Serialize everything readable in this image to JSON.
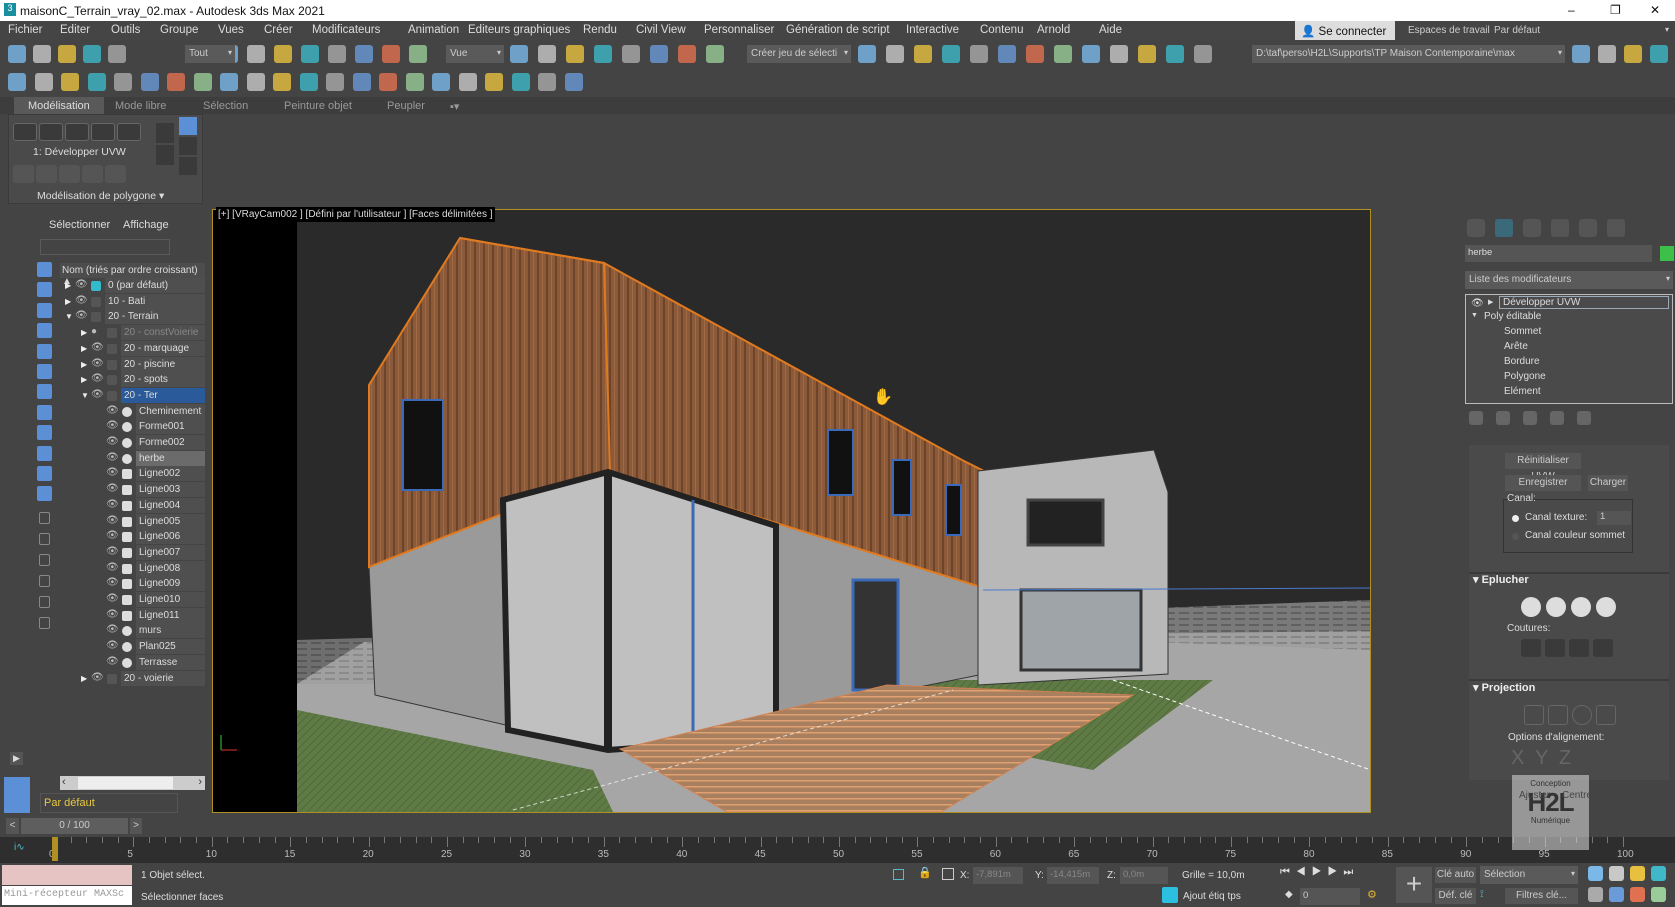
{
  "window": {
    "title": "maisonC_Terrain_vray_02.max - Autodesk 3ds Max 2021",
    "minimize": "–",
    "maximize": "❐",
    "close": "✕"
  },
  "menu": [
    "Fichier",
    "Editer",
    "Outils",
    "Groupe",
    "Vues",
    "Créer",
    "Modificateurs",
    "Animation",
    "Editeurs graphiques",
    "Rendu",
    "Civil View",
    "Personnaliser",
    "Génération de script",
    "Interactive",
    "Contenu",
    "Arnold",
    "Aide"
  ],
  "account": {
    "signin": "Se connecter",
    "workspace_label": "Espaces de travail:",
    "workspace_value": "Par défaut"
  },
  "toolbar": {
    "selection_filter": "Tout",
    "ref_coord": "Vue",
    "named_selection": "Créer jeu de sélecti",
    "project_path": "D:\\taf\\perso\\H2L\\Supports\\TP Maison Contemporaine\\max",
    "row1_icons": [
      "undo-icon",
      "redo-icon",
      "link-icon",
      "unlink-icon",
      "bind-spacewarp-icon"
    ],
    "row1b_icons": [
      "select-object-icon",
      "select-by-name-icon",
      "rect-selection-icon",
      "window-crossing-icon",
      "move-icon",
      "rotate-icon",
      "scale-icon",
      "manipulate-icon"
    ],
    "row1c_icons": [
      "mirror-axis-icon",
      "pivot-icon",
      "keyboard-shortcut-icon",
      "snap-3d-icon",
      "angle-snap-icon",
      "percent-snap-icon",
      "spinner-snap-icon",
      "edit-named-sel-icon"
    ],
    "row1d_icons": [
      "mirror-icon",
      "align-icon",
      "scene-explorer-icon",
      "layer-explorer-icon",
      "toggle-ribbon-icon",
      "curve-editor-icon",
      "schematic-icon",
      "material-editor-icon",
      "render-setup-icon",
      "rendered-frame-icon",
      "render-icon",
      "render-cloud-icon",
      "render-iterative-icon"
    ],
    "row2_icons": [
      "teapot-icon",
      "cloud-icon",
      "render-window-icon",
      "light-icon",
      "camera-icon",
      "box-icon",
      "sphere-icon",
      "torus-icon",
      "teapot-small-icon",
      "cone-icon",
      "sun-icon",
      "plane-icon",
      "array-icon",
      "connect-icon",
      "bone-icon",
      "particle-icon",
      "grass-icon",
      "sphere-material-icon",
      "color-palette-icon",
      "vray-icon",
      "asset-icon",
      "help-icon"
    ],
    "project_icons": [
      "project-settings-icon",
      "project-folder-icon",
      "project-tree-icon",
      "project-switch-icon"
    ]
  },
  "ribbon": {
    "tabs": [
      "Modélisation",
      "Mode libre",
      "Sélection",
      "Peinture objet",
      "Peupler"
    ],
    "modifier": "1: Développer UVW",
    "panel": "Modélisation de polygone ▾"
  },
  "explorer": {
    "tabs": [
      "Sélectionner",
      "Affichage"
    ],
    "column_header": "Nom (triés par ordre croissant)",
    "items": [
      {
        "label": "0 (par défaut)",
        "level": 0,
        "expand": "▶",
        "kind": "layer-active"
      },
      {
        "label": "10 - Bati",
        "level": 0,
        "expand": "▶",
        "kind": "layer"
      },
      {
        "label": "20 - Terrain",
        "level": 0,
        "expand": "▼",
        "kind": "layer"
      },
      {
        "label": "20 - constVoierie",
        "level": 1,
        "expand": "▶",
        "kind": "layer",
        "hidden": true
      },
      {
        "label": "20 - marquage",
        "level": 1,
        "expand": "▶",
        "kind": "layer"
      },
      {
        "label": "20 - piscine",
        "level": 1,
        "expand": "▶",
        "kind": "layer"
      },
      {
        "label": "20 - spots",
        "level": 1,
        "expand": "▶",
        "kind": "layer"
      },
      {
        "label": "20 - Ter",
        "level": 1,
        "expand": "▼",
        "kind": "layer",
        "selected": true
      },
      {
        "label": "Cheminement",
        "level": 2,
        "kind": "object"
      },
      {
        "label": "Forme001",
        "level": 2,
        "kind": "object"
      },
      {
        "label": "Forme002",
        "level": 2,
        "kind": "object"
      },
      {
        "label": "herbe",
        "level": 2,
        "kind": "object",
        "highlight": true
      },
      {
        "label": "Ligne002",
        "level": 2,
        "kind": "shape"
      },
      {
        "label": "Ligne003",
        "level": 2,
        "kind": "shape"
      },
      {
        "label": "Ligne004",
        "level": 2,
        "kind": "shape"
      },
      {
        "label": "Ligne005",
        "level": 2,
        "kind": "shape"
      },
      {
        "label": "Ligne006",
        "level": 2,
        "kind": "shape"
      },
      {
        "label": "Ligne007",
        "level": 2,
        "kind": "shape"
      },
      {
        "label": "Ligne008",
        "level": 2,
        "kind": "shape"
      },
      {
        "label": "Ligne009",
        "level": 2,
        "kind": "shape"
      },
      {
        "label": "Ligne010",
        "level": 2,
        "kind": "shape"
      },
      {
        "label": "Ligne011",
        "level": 2,
        "kind": "shape"
      },
      {
        "label": "murs",
        "level": 2,
        "kind": "object"
      },
      {
        "label": "Plan025",
        "level": 2,
        "kind": "object"
      },
      {
        "label": "Terrasse",
        "level": 2,
        "kind": "object"
      },
      {
        "label": "20 - voierie",
        "level": 1,
        "expand": "▶",
        "kind": "layer"
      }
    ],
    "side_icons": [
      "display-all-icon",
      "display-geometry-icon",
      "display-lights-icon",
      "display-cameras-icon",
      "display-helpers-icon",
      "display-spacewarps-icon",
      "display-groups-icon",
      "display-xrefs-icon",
      "display-bones-icon",
      "display-containers-icon",
      "display-frozen-icon",
      "display-hidden-icon"
    ],
    "layer_filter": "Par défaut"
  },
  "viewport": {
    "label": "[+] [VRayCam002 ] [Défini par l'utilisateur ] [Faces délimitées ]"
  },
  "colors": {
    "wood": "#8a5a3a",
    "edge": "#e07a20",
    "selection_blue": "#2a5a9a",
    "object_color": "#3cc04a",
    "frame": "#b09020"
  },
  "command_panel": {
    "tab_icons": [
      "create-icon",
      "modify-icon",
      "hierarchy-icon",
      "motion-icon",
      "display-icon",
      "utilities-icon"
    ],
    "object_name": "herbe",
    "modifier_list": "Liste des modificateurs",
    "stack": [
      "Développer UVW",
      "Poly éditable",
      "Sommet",
      "Arête",
      "Bordure",
      "Polygone",
      "Elément"
    ],
    "reset_uvw": "Réinitialiser UVW",
    "save": "Enregistrer",
    "load": "Charger",
    "channel_label": "Canal:",
    "map_channel": "Canal texture:",
    "map_channel_value": "1",
    "vertex_color_channel": "Canal couleur sommet",
    "peel": "Eplucher",
    "seams": "Coutures:",
    "projection": "Projection",
    "align_options": "Options d'alignement:",
    "align_axes": [
      "X",
      "Y",
      "Z"
    ],
    "fit": "Ajuster",
    "center": "Centrer"
  },
  "watermark": {
    "top": "Conception",
    "logo": "H2L",
    "bottom": "Numérique"
  },
  "timeline": {
    "frame": "0 / 100",
    "ticks": [
      0,
      5,
      10,
      15,
      20,
      25,
      30,
      35,
      40,
      45,
      50,
      55,
      60,
      65,
      70,
      75,
      80,
      85,
      90,
      95,
      100
    ],
    "current": 0
  },
  "status": {
    "maxscript": "Mini-récepteur MAXSc",
    "selected": "1 Objet sélect.",
    "prompt": "Sélectionner faces",
    "x_label": "X:",
    "x": "-7,891m",
    "y_label": "Y:",
    "y": "-14,415m",
    "z_label": "Z:",
    "z": "0,0m",
    "grid": "Grille = 10,0m",
    "add_tag": "Ajout étiq tps",
    "frame_field": "0",
    "auto_key": "Clé auto",
    "set_key": "Déf. clé",
    "key_mode": "Sélection",
    "key_filters": "Filtres clé..."
  }
}
